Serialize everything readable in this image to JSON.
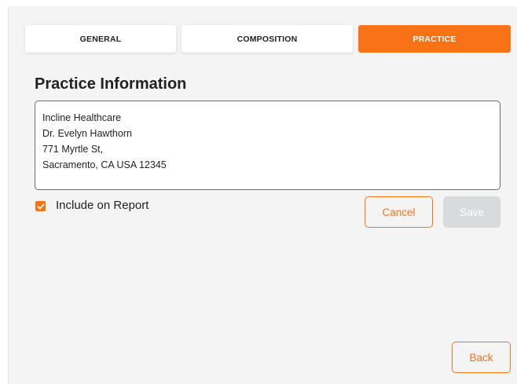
{
  "tabs": [
    {
      "label": "GENERAL",
      "active": false
    },
    {
      "label": "COMPOSITION",
      "active": false
    },
    {
      "label": "PRACTICE",
      "active": true
    }
  ],
  "section_title": "Practice Information",
  "practice_info": {
    "lines": [
      "Incline Healthcare",
      "Dr. Evelyn Hawthorn",
      "771 Myrtle St,",
      "Sacramento, CA USA 12345"
    ]
  },
  "include_on_report": {
    "label": "Include on Report",
    "checked": true
  },
  "buttons": {
    "cancel": "Cancel",
    "save": "Save",
    "back": "Back"
  },
  "colors": {
    "accent": "#f97316",
    "background": "#f4f4f4",
    "disabled": "#d9dadd"
  }
}
